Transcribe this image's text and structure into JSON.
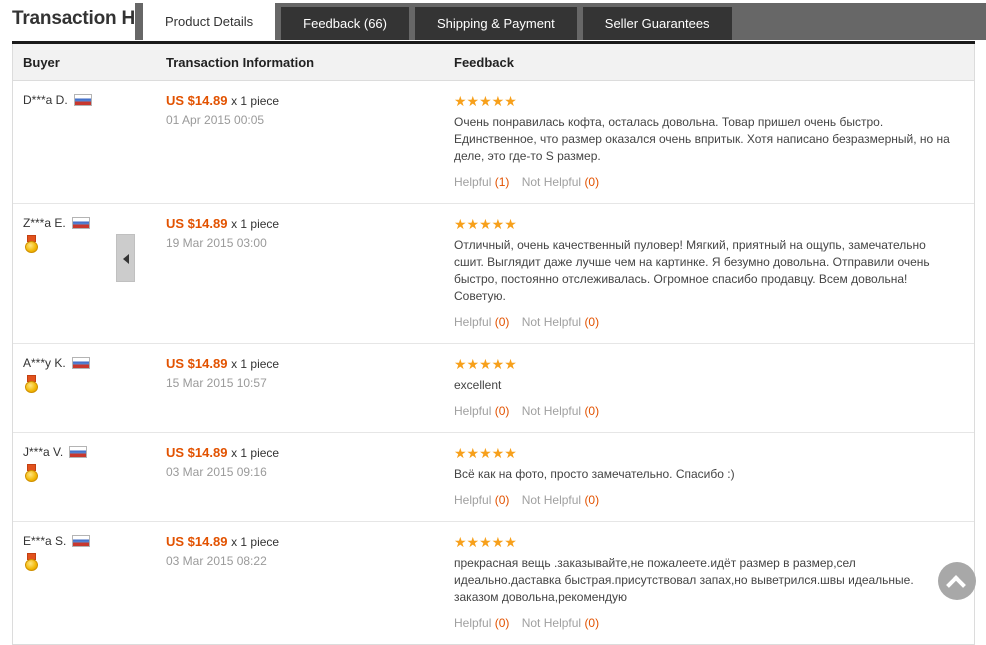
{
  "page_title": "Transaction History",
  "tabs": [
    {
      "label": "Product Details",
      "active": true
    },
    {
      "label": "Feedback (66)",
      "active": false
    },
    {
      "label": "Shipping & Payment",
      "active": false
    },
    {
      "label": "Seller Guarantees",
      "active": false
    }
  ],
  "table": {
    "headers": {
      "buyer": "Buyer",
      "transaction": "Transaction Information",
      "feedback": "Feedback"
    },
    "helpful_label": "Helpful",
    "not_helpful_label": "Not Helpful",
    "rows": [
      {
        "buyer": "D***a D.",
        "country_flag": "russia-flag",
        "has_medal": false,
        "price": "US $14.89",
        "quantity": "x 1 piece",
        "date": "01 Apr 2015 00:05",
        "rating": 5,
        "stars": "★★★★★",
        "feedback": "Очень понравилась кофта, осталась довольна. Товар пришел очень быстро. Единственное, что размер оказался очень впритык. Хотя написано безразмерный, но на деле, это где-то S размер.",
        "helpful_count": "(1)",
        "not_helpful_count": "(0)"
      },
      {
        "buyer": "Z***a E.",
        "country_flag": "russia-flag",
        "has_medal": true,
        "price": "US $14.89",
        "quantity": "x 1 piece",
        "date": "19 Mar 2015 03:00",
        "rating": 5,
        "stars": "★★★★★",
        "feedback": "Отличный, очень качественный пуловер! Мягкий, приятный на ощупь, замечательно сшит. Выглядит даже лучше чем на картинке. Я безумно довольна. Отправили очень быстро, постоянно отслеживалась. Огромное спасибо продавцу. Всем довольна! Советую.",
        "helpful_count": "(0)",
        "not_helpful_count": "(0)"
      },
      {
        "buyer": "A***y K.",
        "country_flag": "russia-flag",
        "has_medal": true,
        "price": "US $14.89",
        "quantity": "x 1 piece",
        "date": "15 Mar 2015 10:57",
        "rating": 5,
        "stars": "★★★★★",
        "feedback": "excellent",
        "helpful_count": "(0)",
        "not_helpful_count": "(0)"
      },
      {
        "buyer": "J***a V.",
        "country_flag": "russia-flag",
        "has_medal": true,
        "price": "US $14.89",
        "quantity": "x 1 piece",
        "date": "03 Mar 2015 09:16",
        "rating": 5,
        "stars": "★★★★★",
        "feedback": "Всё как на фото, просто замечательно. Спасибо :)",
        "helpful_count": "(0)",
        "not_helpful_count": "(0)"
      },
      {
        "buyer": "E***a S.",
        "country_flag": "russia-flag",
        "has_medal": true,
        "price": "US $14.89",
        "quantity": "x 1 piece",
        "date": "03 Mar 2015 08:22",
        "rating": 5,
        "stars": "★★★★★",
        "feedback": "прекрасная вещь .заказывайте,не пожалеете.идёт размер в размер,сел идеально.даставка быстрая.присутствовал запах,но выветрился.швы идеальные. заказом довольна,рекомендую",
        "helpful_count": "(0)",
        "not_helpful_count": "(0)"
      }
    ]
  },
  "colors": {
    "accent_orange": "#e25200",
    "star_orange": "#f7a01b",
    "tabbar_bg": "#676767",
    "tab_bg": "#343434"
  }
}
